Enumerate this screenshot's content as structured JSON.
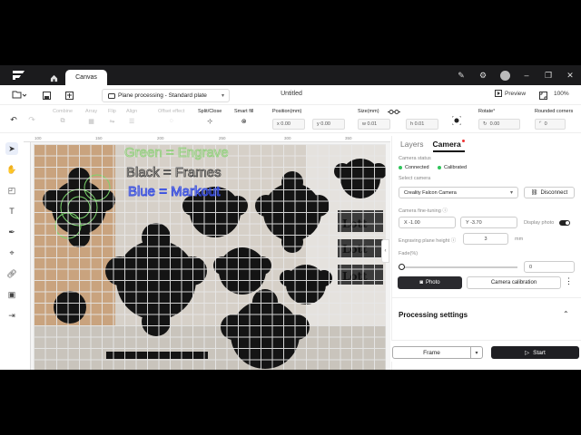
{
  "titlebar": {
    "canvas_tab": "Canvas"
  },
  "header": {
    "plane_select": "Plane processing - Standard plate",
    "doc_title": "Untitled",
    "preview_label": "Preview",
    "zoom": "100%"
  },
  "toolbar": {
    "combine": "Combine",
    "array": "Array",
    "flip": "Flip",
    "align": "Align",
    "offset_effect": "Offset effect",
    "split_close": "Split/Close",
    "smart_fill": "Smart fill",
    "position_label": "Position(mm)",
    "pos_x": "x 0.00",
    "pos_y": "y 0.00",
    "size_label": "Size(mm)",
    "size_w": "w 0.01",
    "size_h": "h 0.01",
    "rotate_label": "Rotate°",
    "rotate_value": "0.00",
    "rounded_label": "Rounded corners",
    "rounded_value": "0"
  },
  "ruler": {
    "ticks": [
      "100",
      "150",
      "200",
      "250",
      "300",
      "350"
    ]
  },
  "canvas_text": {
    "line1": "Green = Engrave",
    "line2": "Black = Frames",
    "line3": "Blue = Markout"
  },
  "panel": {
    "tab_layers": "Layers",
    "tab_camera": "Camera",
    "camera_status_label": "Camera status",
    "status_connected": "Connected",
    "status_calibrated": "Calibrated",
    "select_camera_label": "Select camera",
    "camera_name": "Creality Falcon Camera",
    "disconnect_label": "Disconnect",
    "fine_tuning_label": "Camera fine-tuning",
    "fine_x": "X -1.00",
    "fine_y": "Y -3.70",
    "display_photo_label": "Display photo",
    "engraving_height_label": "Engraving plane height",
    "engraving_height_value": "3",
    "engraving_height_unit": "mm",
    "fade_label": "Fade(%)",
    "fade_value": "0",
    "photo_btn": "Photo",
    "calibration_btn": "Camera calibration",
    "processing_settings": "Processing settings",
    "display_photo_on": true
  },
  "actions": {
    "frame": "Frame",
    "start": "Start"
  },
  "colors": {
    "accent_dark": "#1f1f23",
    "status_green": "#2fc45a",
    "notify_red": "#e33333"
  }
}
